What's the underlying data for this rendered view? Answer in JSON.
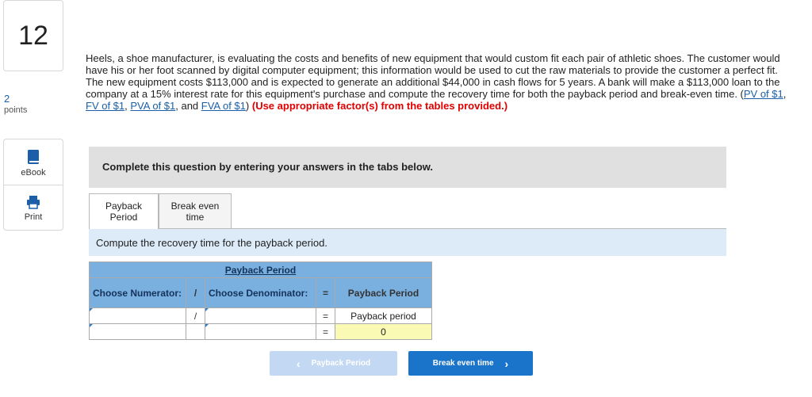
{
  "question": {
    "number": "12",
    "points_value": "2",
    "points_label": "points",
    "text_before": "Heels, a shoe manufacturer, is evaluating the costs and benefits of new equipment that would custom fit each pair of athletic shoes. The customer would have his or her foot scanned by digital computer equipment; this information would be used to cut the raw materials to provide the customer a perfect fit. The new equipment costs $113,000 and is expected to generate an additional $44,000 in cash flows for 5 years. A bank will make a $113,000 loan to the company at a 15% interest rate for this equipment's purchase and compute the recovery time for both the payback period and break-even time. (",
    "link_pv": "PV of $1",
    "link_fv": "FV of $1",
    "link_pva": "PVA of $1",
    "link_fva": "FVA of $1",
    "sep1": ", ",
    "sep2": ", ",
    "sep3": ", and ",
    "close_paren": ") ",
    "red_note": "(Use appropriate factor(s) from the tables provided.)"
  },
  "sidebar": {
    "ebook_label": "eBook",
    "print_label": "Print"
  },
  "instruction": "Complete this question by entering your answers in the tabs below.",
  "tabs": [
    {
      "line1": "Payback",
      "line2": "Period"
    },
    {
      "line1": "Break even",
      "line2": "time"
    }
  ],
  "subinstruction": "Compute the recovery time for the payback period.",
  "table": {
    "title": "Payback Period",
    "col_numerator": "Choose Numerator:",
    "divide_symbol": "/",
    "col_denominator": "Choose Denominator:",
    "equals_symbol": "=",
    "col_result": "Payback Period",
    "row1": {
      "numerator": "",
      "divide": "/",
      "denominator": "",
      "equals": "=",
      "result": "Payback period"
    },
    "row2": {
      "numerator": "",
      "divide": "",
      "denominator": "",
      "equals": "=",
      "result": "0"
    }
  },
  "nav": {
    "prev_label": "Payback Period",
    "next_label": "Break even time"
  },
  "colors": {
    "link": "#1a5fa8",
    "accent_button": "#1a74c9",
    "disabled_button": "#c3d8f2",
    "table_header": "#7ab0e0",
    "result_highlight": "#fafab4"
  }
}
